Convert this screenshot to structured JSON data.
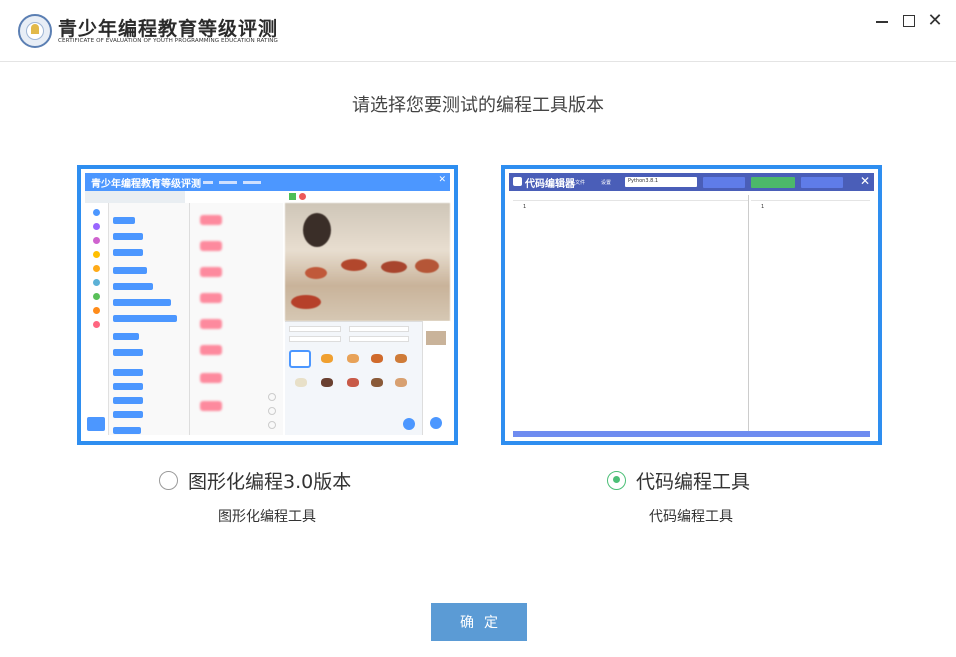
{
  "app": {
    "title": "青少年编程教育等级评测",
    "subtitle": "CERTIFICATE OF EVALUATION OF YOUTH PROGRAMMING EDUCATION RATING"
  },
  "window_controls": {
    "close": "✕"
  },
  "prompt": "请选择您要测试的编程工具版本",
  "options": [
    {
      "label": "图形化编程3.0版本",
      "caption": "图形化编程工具",
      "selected": false,
      "preview": {
        "header_title": "青少年编程教育等级评测",
        "close": "✕"
      }
    },
    {
      "label": "代码编程工具",
      "caption": "代码编程工具",
      "selected": true,
      "preview": {
        "header_title": "代码编辑器",
        "menu_file": "文件",
        "menu_settings": "设置",
        "python_select": "Python3.8.1",
        "line_number_left": "1",
        "line_number_right": "1",
        "close": "✕"
      }
    }
  ],
  "confirm_label": "确定",
  "colors": {
    "card_border": "#2e8ef0",
    "radio_selected": "#4cbf77",
    "confirm_bg": "#5b9bd5",
    "scratch_blue": "#4c97ff",
    "code_header": "#4a5eb8"
  }
}
